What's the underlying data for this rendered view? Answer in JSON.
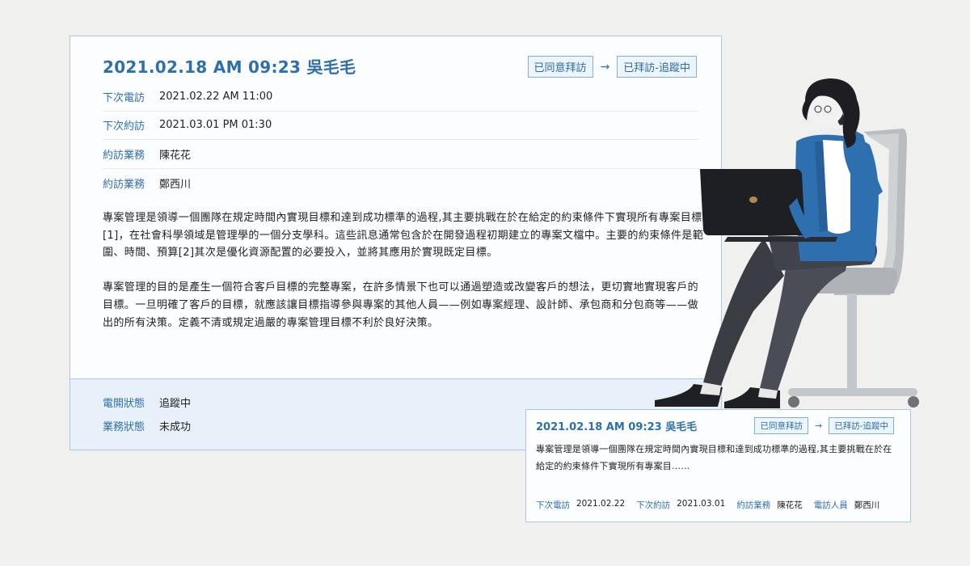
{
  "record": {
    "title": "2021.02.18  AM 09:23 吳毛毛",
    "status_from": "已同意拜訪",
    "status_arrow": "→",
    "status_to": "已拜訪-追蹤中",
    "rows": [
      {
        "label": "下次電訪",
        "value": "2021.02.22  AM 11:00"
      },
      {
        "label": "下次約訪",
        "value": "2021.03.01  PM 01:30"
      },
      {
        "label": "約訪業務",
        "value": "陳花花"
      },
      {
        "label": "約訪業務",
        "value": "鄭西川"
      }
    ],
    "paragraph1": "專案管理是領導一個團隊在規定時間內實現目標和達到成功標準的過程,其主要挑戰在於在給定的約束條件下實現所有專案目標[1]，在社會科學領域是管理學的一個分支學科。這些訊息通常包含於在開發過程初期建立的專案文檔中。主要的約束條件是範圍、時間、預算[2]其次是優化資源配置的必要投入，並將其應用於實現既定目標。",
    "paragraph2": "專案管理的目的是產生一個符合客戶目標的完整專案，在許多情景下也可以通過塑造或改變客戶的想法，更切實地實現客戶的目標。一旦明確了客戶的目標，就應該讓目標指導參與專案的其他人員——例如專案經理、設計師、承包商和分包商等——做出的所有決策。定義不清或規定過嚴的專案管理目標不利於良好決策。",
    "footer": [
      {
        "label": "電開狀態",
        "value": "追蹤中"
      },
      {
        "label": "業務狀態",
        "value": "未成功"
      }
    ]
  },
  "mini": {
    "title": "2021.02.18  AM 09:23 吳毛毛",
    "status_from": "已同意拜訪",
    "status_arrow": "→",
    "status_to": "已拜訪-追蹤中",
    "desc": "專案管理是領導一個團隊在規定時間內實現目標和達到成功標準的過程,其主要挑戰在於在給定的約束條件下實現所有專案目……",
    "meta": [
      {
        "label": "下次電訪",
        "value": "2021.02.22"
      },
      {
        "label": "下次約訪",
        "value": "2021.03.01"
      },
      {
        "label": "約訪業務",
        "value": "陳花花"
      },
      {
        "label": "電訪人員",
        "value": "鄭西川"
      }
    ]
  },
  "colors": {
    "accent": "#2f6fae",
    "border": "#a9c8e6",
    "footer_bg": "#e8f1fa",
    "tag_bg": "#edf5fc"
  },
  "illustration": {
    "icon": "woman-on-phone-with-laptop-illustration"
  }
}
